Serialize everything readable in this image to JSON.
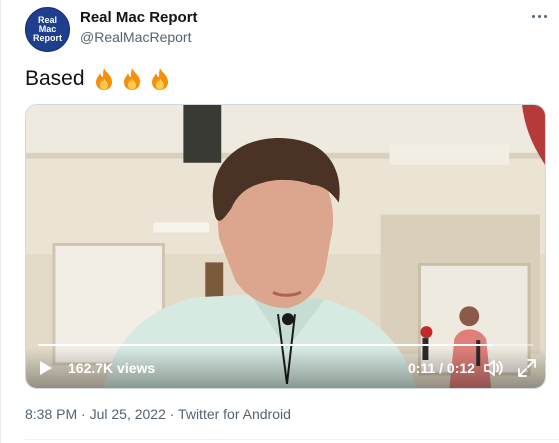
{
  "author": {
    "avatar_lines": [
      "Real",
      "Mac",
      "Report"
    ],
    "display_name": "Real Mac Report",
    "handle": "@RealMacReport"
  },
  "tweet": {
    "text": "Based",
    "emoji": [
      "fire",
      "fire",
      "fire"
    ]
  },
  "video": {
    "views": "162.7K views",
    "time": "0:11 / 0:12",
    "progress": 0.917
  },
  "meta": {
    "timestamp": "8:38 PM · Jul 25, 2022 · Twitter for Android"
  },
  "colors": {
    "avatar_bg": "#1d3f8e",
    "secondary_text": "#536471"
  }
}
